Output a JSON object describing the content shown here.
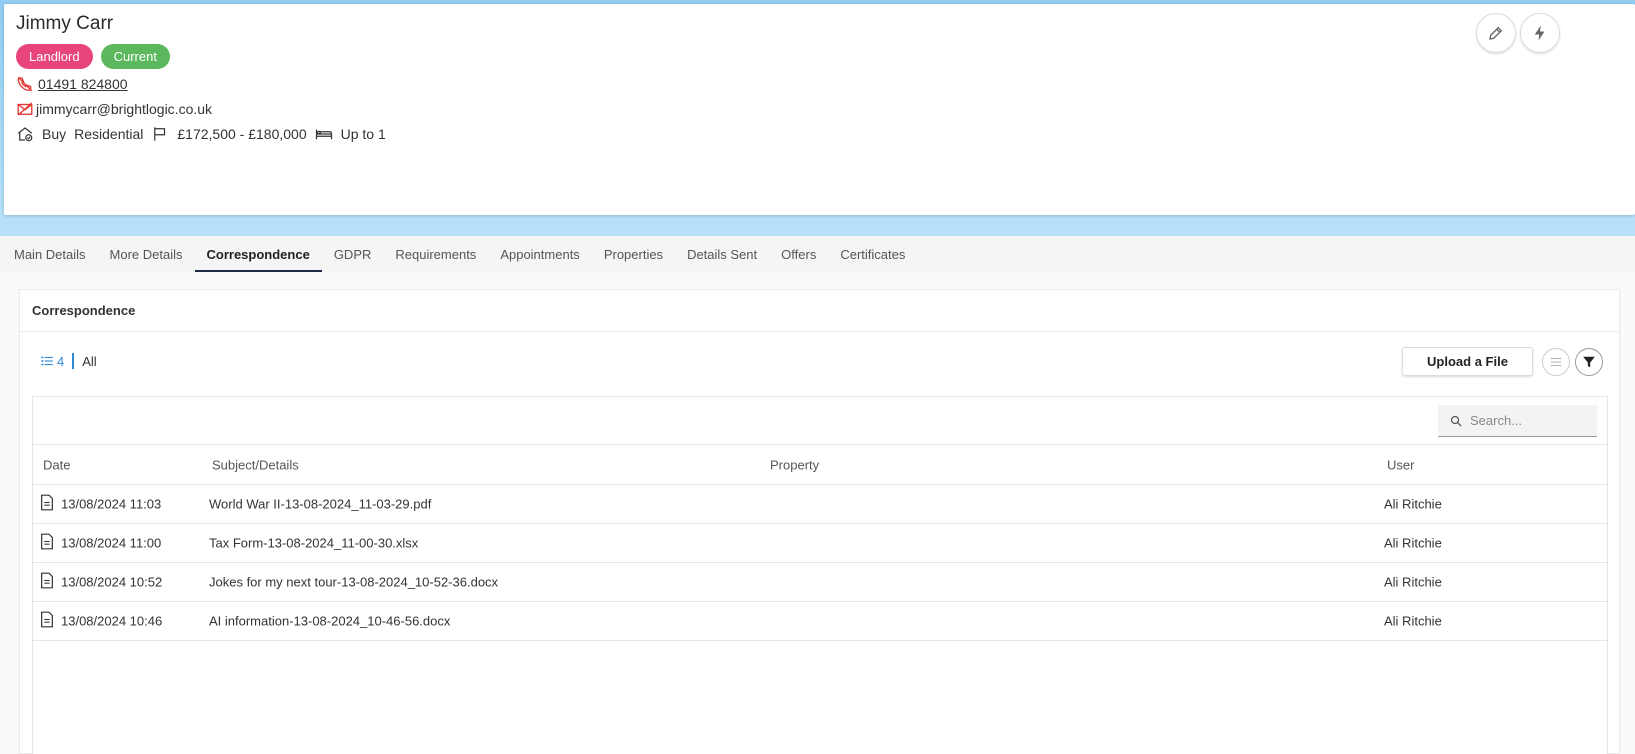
{
  "contact": {
    "name": "Jimmy Carr",
    "badges": [
      {
        "label": "Landlord",
        "color": "#e8457a"
      },
      {
        "label": "Current",
        "color": "#5cb85c"
      }
    ],
    "phone": "01491 824800",
    "email": "jimmycarr@brightlogic.co.uk",
    "requirements": {
      "buy": "Buy",
      "type": "Residential",
      "price_range": "£172,500 - £180,000",
      "beds": "Up to 1"
    }
  },
  "header_actions": [
    {
      "name": "edit-button",
      "icon": "pencil-icon"
    },
    {
      "name": "quick-actions-button",
      "icon": "lightning-icon"
    }
  ],
  "tabs": [
    {
      "label": "Main Details",
      "active": false
    },
    {
      "label": "More Details",
      "active": false
    },
    {
      "label": "Correspondence",
      "active": true
    },
    {
      "label": "GDPR",
      "active": false
    },
    {
      "label": "Requirements",
      "active": false
    },
    {
      "label": "Appointments",
      "active": false
    },
    {
      "label": "Properties",
      "active": false
    },
    {
      "label": "Details Sent",
      "active": false
    },
    {
      "label": "Offers",
      "active": false
    },
    {
      "label": "Certificates",
      "active": false
    }
  ],
  "panel": {
    "title": "Correspondence",
    "count": "4",
    "filter_label": "All",
    "upload_label": "Upload a File",
    "search_placeholder": "Search..."
  },
  "table": {
    "columns": [
      "Date",
      "Subject/Details",
      "Property",
      "User"
    ],
    "rows": [
      {
        "date": "13/08/2024 11:03",
        "subject": "World War II-13-08-2024_11-03-29.pdf",
        "property": "",
        "user": "Ali Ritchie"
      },
      {
        "date": "13/08/2024 11:00",
        "subject": "Tax Form-13-08-2024_11-00-30.xlsx",
        "property": "",
        "user": "Ali Ritchie"
      },
      {
        "date": "13/08/2024 10:52",
        "subject": "Jokes for my next tour-13-08-2024_10-52-36.docx",
        "property": "",
        "user": "Ali Ritchie"
      },
      {
        "date": "13/08/2024 10:46",
        "subject": "AI information-13-08-2024_10-46-56.docx",
        "property": "",
        "user": "Ali Ritchie"
      }
    ]
  },
  "colors": {
    "accent_blue": "#2f8bd8",
    "tab_underline": "#1f2a44",
    "icon_red": "#e53935"
  }
}
